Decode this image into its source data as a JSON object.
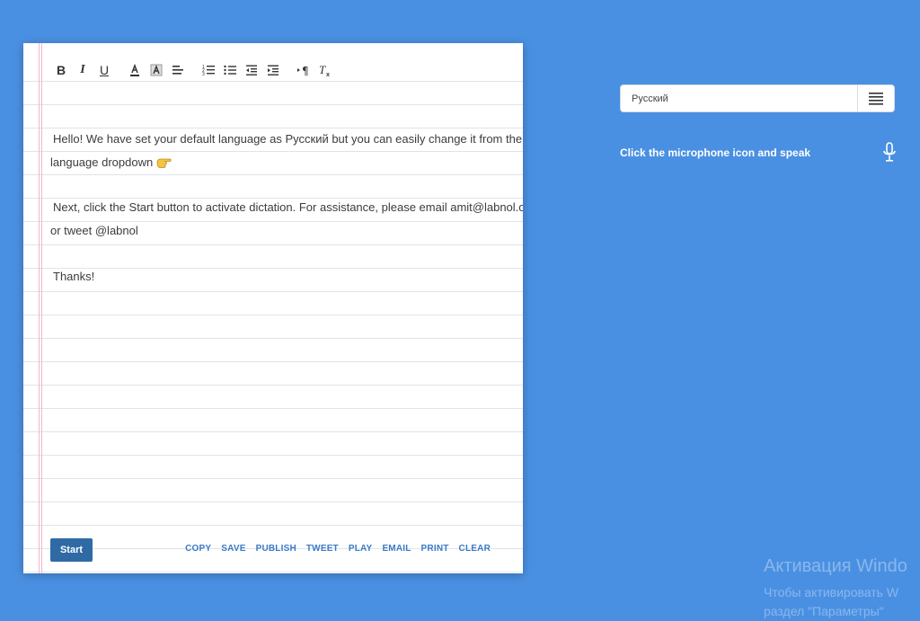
{
  "toolbar": {
    "bold": "B",
    "italic": "I",
    "underline": "U"
  },
  "content": {
    "line1": "Hello!  We have set your default language as  Русский but you can easily change it from the",
    "line2": "language dropdown",
    "line3": "Next, click the Start button to activate dictation.  For assistance,  please email amit@labnol.org",
    "line4": "or tweet @labnol",
    "line5": "Thanks!"
  },
  "buttons": {
    "start": "Start",
    "copy": "COPY",
    "save": "SAVE",
    "publish": "PUBLISH",
    "tweet": "TWEET",
    "play": "PLAY",
    "email": "EMAIL",
    "print": "PRINT",
    "clear": "CLEAR"
  },
  "language": {
    "selected": "Русский"
  },
  "hint": "Click the microphone icon and speak",
  "watermark": {
    "title": "Активация Windo",
    "line1": "Чтобы активировать W",
    "line2": "раздел \"Параметры\""
  },
  "colors": {
    "background": "#4a90e2",
    "start_button": "#2f6aa5",
    "action_link": "#3b7ac6"
  }
}
